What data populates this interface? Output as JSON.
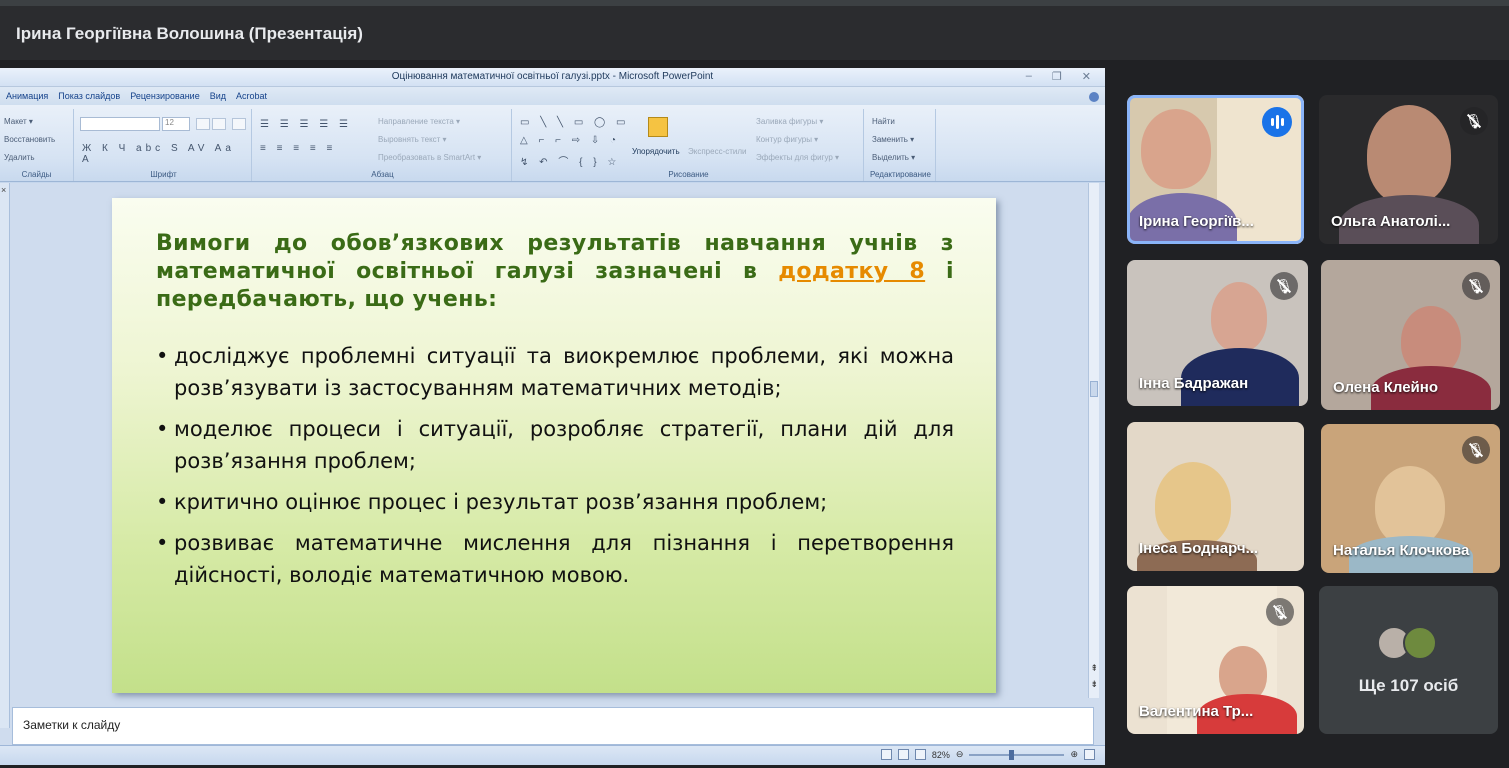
{
  "meet": {
    "presenter_title": "Ірина Георгіївна Волошина (Презентація)",
    "participants": [
      {
        "name": "Ірина Георгіїв...",
        "state": "speaking"
      },
      {
        "name": "Ольга Анатолі...",
        "state": "muted"
      },
      {
        "name": "Інна Бадражан",
        "state": "muted"
      },
      {
        "name": "Олена Клейно",
        "state": "muted"
      },
      {
        "name": "Інеса Боднарч...",
        "state": "unmuted"
      },
      {
        "name": "Наталья Клочкова",
        "state": "muted"
      },
      {
        "name": "Валентина Тр...",
        "state": "muted"
      }
    ],
    "more_people": "Ще 107 осіб",
    "accent_color": "#1a73e8"
  },
  "ppt": {
    "window_title": "Оцінювання математичної освітньої галузі.pptx - Microsoft PowerPoint",
    "window_buttons": [
      "–",
      "❐",
      "✕"
    ],
    "menu": [
      "Анимация",
      "Показ слайдов",
      "Рецензирование",
      "Вид",
      "Acrobat"
    ],
    "ribbon": {
      "slides_group": {
        "label": "Слайды",
        "items": [
          "Макет ▾",
          "Восстановить",
          "Удалить"
        ]
      },
      "font_group": {
        "label": "Шрифт",
        "size": "12"
      },
      "paragraph_group": {
        "label": "Абзац",
        "items": [
          "Направление текста ▾",
          "Выровнять текст ▾",
          "Преобразовать в SmartArt ▾"
        ]
      },
      "drawing_group": {
        "label": "Рисование",
        "arrange": "Упорядочить",
        "styles": "Экспресс-стили",
        "items": [
          "Заливка фигуры ▾",
          "Контур фигуры ▾",
          "Эффекты для фигур ▾"
        ]
      },
      "editing_group": {
        "label": "Редактирование",
        "items": [
          "Найти",
          "Заменить ▾",
          "Выделить ▾"
        ]
      }
    },
    "slide": {
      "heading_before_link": "Вимоги до обов’язкових результатів навчання учнів з математичної освітньої галузі зазначені в ",
      "heading_link": "додатку 8",
      "heading_after_link": " і передбачають, що учень:",
      "bullets": [
        "досліджує проблемні ситуації та виокремлює проблеми, які можна розв’язувати із застосуванням математичних методів;",
        "моделює процеси і ситуації, розробляє стратегії, плани дій для розв’язання проблем;",
        "критично оцінює процес і результат розв’язання проблем;",
        "розвиває математичне мислення для пізнання і перетворення дійсності, володіє математичною мовою."
      ]
    },
    "notes_placeholder": "Заметки к слайду",
    "zoom": "82%"
  }
}
